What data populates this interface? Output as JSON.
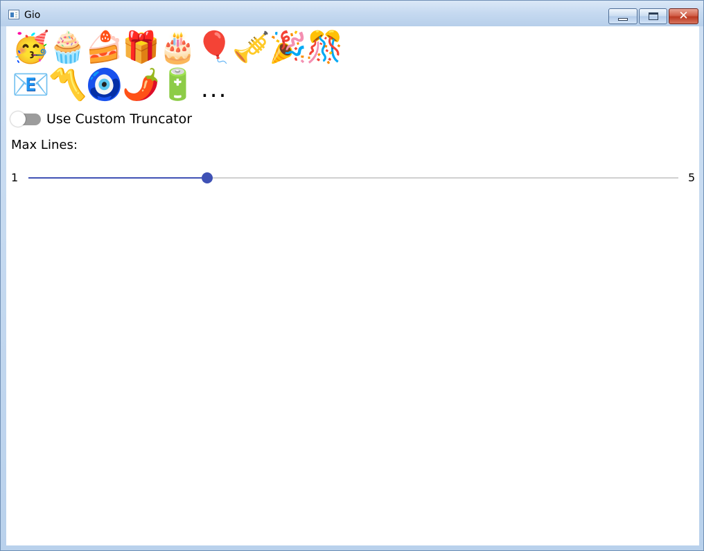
{
  "window": {
    "title": "Gio",
    "buttons": {
      "minimize": "minimize-icon",
      "maximize": "maximize-icon",
      "close": "close-icon"
    }
  },
  "emoji_text": {
    "row1": [
      "🥳",
      "🧁",
      "🍰",
      "🎁",
      "🎂",
      "🎈",
      "🎺",
      "🎉",
      "🎊"
    ],
    "row2": [
      "📧",
      "〽️",
      "🧿",
      "🌶️",
      "🔋"
    ],
    "ellipsis": "..."
  },
  "toggle": {
    "label": "Use Custom Truncator",
    "checked": false
  },
  "max_lines": {
    "label": "Max Lines:",
    "min_label": "1",
    "max_label": "5",
    "min": 1,
    "max": 5,
    "value": 2.1
  },
  "colors": {
    "accent": "#3f51b5",
    "switch_track_off": "#9c9c9c",
    "rail": "#d0d0d0"
  }
}
